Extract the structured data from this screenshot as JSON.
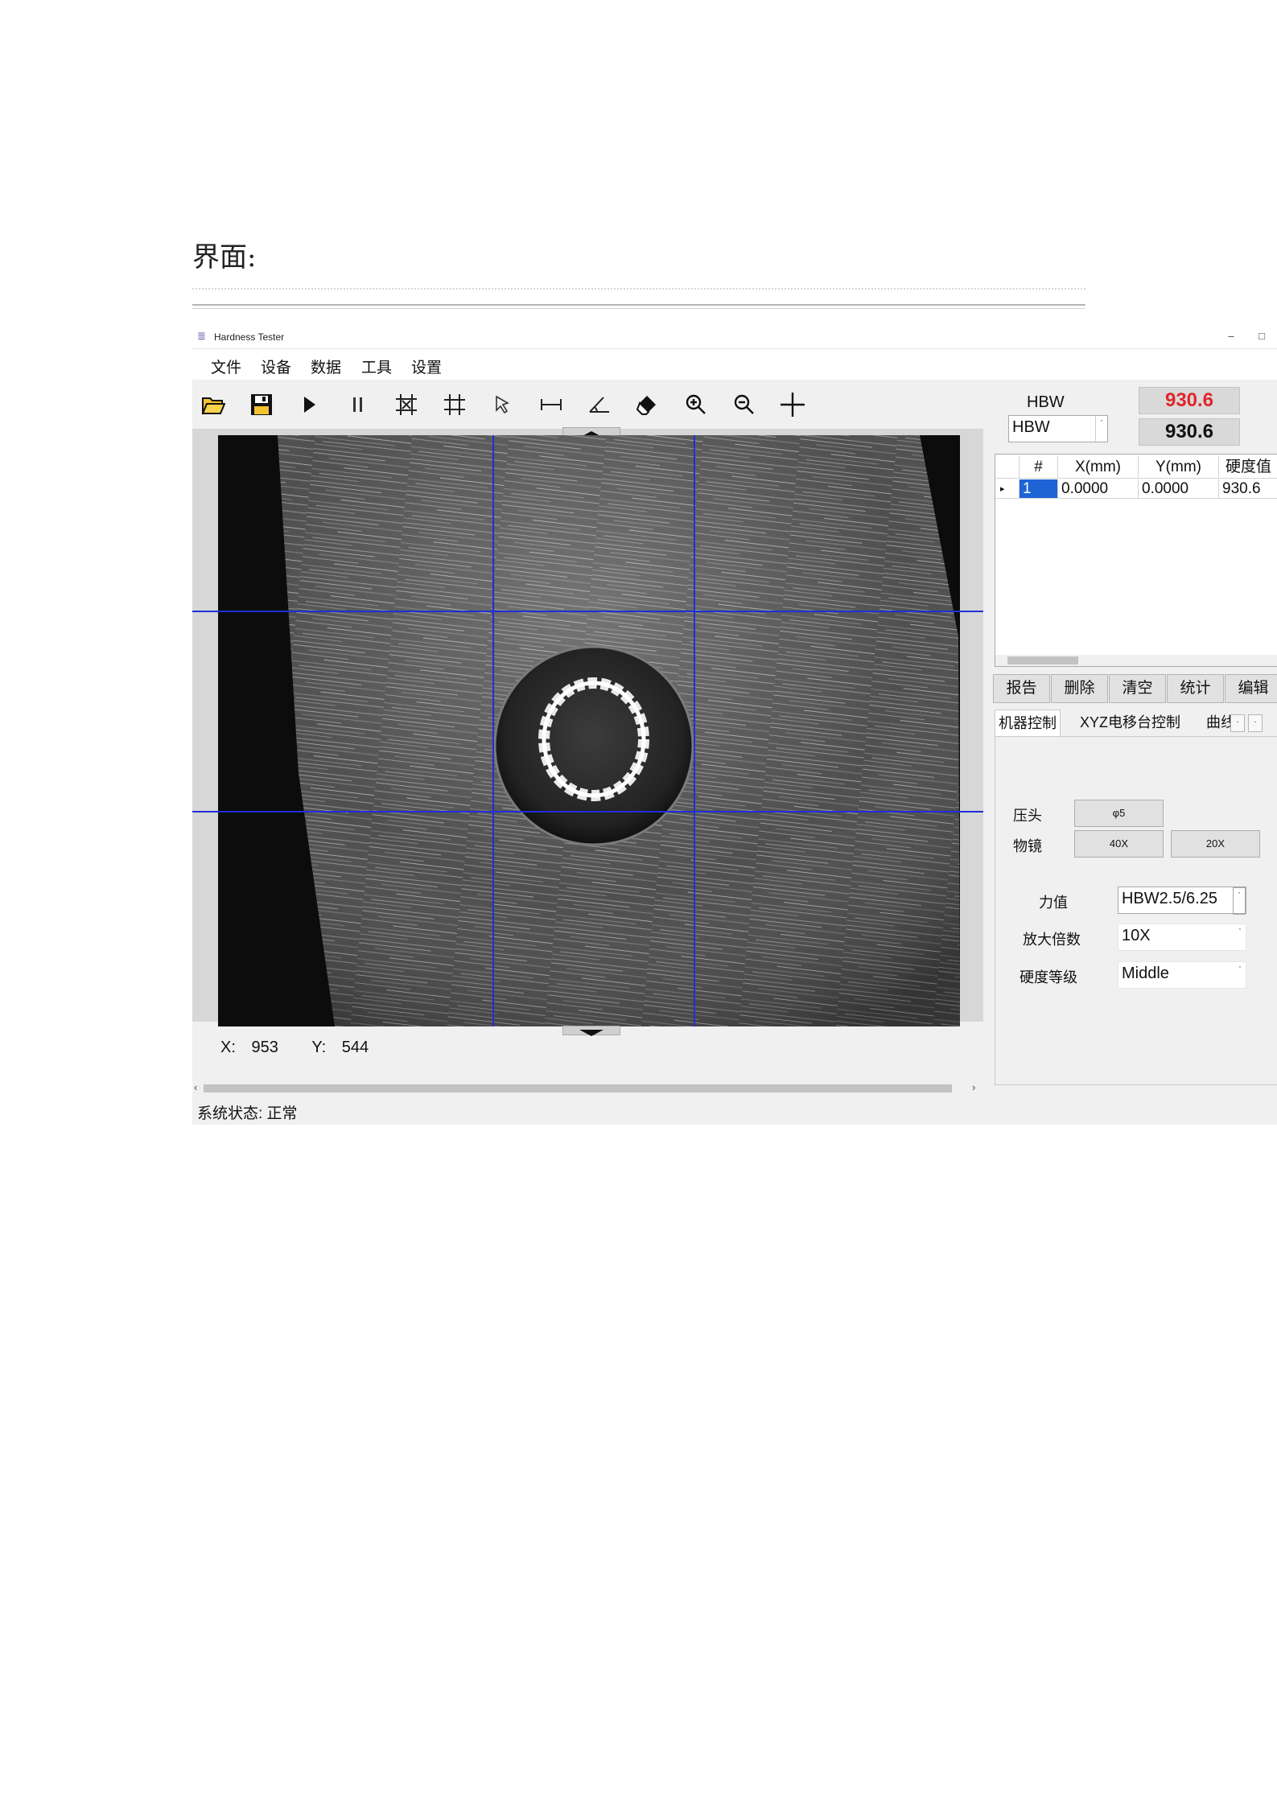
{
  "document": {
    "heading": "界面:"
  },
  "window": {
    "title": "Hardness Tester",
    "minimize": "–",
    "maximize": "□"
  },
  "menu": [
    "文件",
    "设备",
    "数据",
    "工具",
    "设置"
  ],
  "toolbar": {
    "items": [
      "open-folder",
      "save",
      "play",
      "pause",
      "auto-measure",
      "grid",
      "select-pointer",
      "measure-distance",
      "measure-angle",
      "eraser",
      "zoom-in",
      "zoom-out",
      "crosshair"
    ]
  },
  "viewer": {
    "coordinates": {
      "x_label": "X:",
      "x_value": "953",
      "y_label": "Y:",
      "y_value": "544"
    }
  },
  "hardness": {
    "scale_label": "HBW",
    "value_primary": "930.6",
    "value_primary_color": "#e0262b",
    "scale_select": "HBW",
    "value_secondary": "930.6"
  },
  "results_table": {
    "columns": [
      "#",
      "X(mm)",
      "Y(mm)",
      "硬度值"
    ],
    "rows": [
      {
        "index": "1",
        "x": "0.0000",
        "y": "0.0000",
        "hardness": "930.6"
      }
    ]
  },
  "actions": [
    "报告",
    "删除",
    "清空",
    "统计",
    "编辑"
  ],
  "tabs": [
    "机器控制",
    "XYZ电移台控制",
    "曲线"
  ],
  "machine_control": {
    "indenter_label": "压头",
    "indenter_button": "φ5",
    "objective_label": "物镜",
    "objective_buttons": [
      "40X",
      "20X"
    ],
    "force_label": "力值",
    "force_value": "HBW2.5/6.25",
    "magnification_label": "放大倍数",
    "magnification_value": "10X",
    "hardness_level_label": "硬度等级",
    "hardness_level_value": "Middle"
  },
  "status": {
    "text": "系统状态: 正常"
  }
}
